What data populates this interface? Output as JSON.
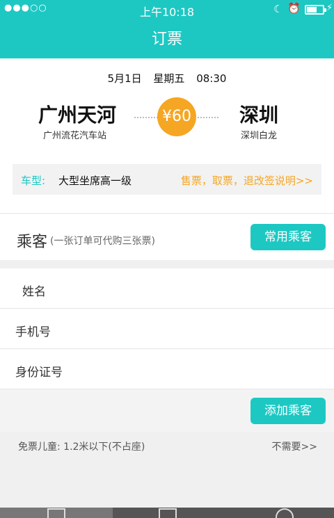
{
  "status_bar": {
    "signal": "●●●○○",
    "time": "上午10:18"
  },
  "nav": {
    "title": "订票"
  },
  "trip": {
    "date": "5月1日",
    "weekday": "星期五",
    "time": "08:30",
    "from_city": "广州天河",
    "from_station": "广州流花汽车站",
    "to_city": "深圳",
    "to_station": "深圳白龙",
    "price": "¥60"
  },
  "vehicle": {
    "label": "车型:",
    "value": "大型坐席高一级",
    "link": "售票，取票，退改签说明>>"
  },
  "passenger": {
    "title": "乘客",
    "note": "(一张订单可代购三张票)",
    "common_button": "常用乘客"
  },
  "form": {
    "name_label": "姓名",
    "phone_label": "手机号",
    "id_label": "身份证号"
  },
  "add_button": "添加乘客",
  "child": {
    "text": "免票儿童: 1.2米以下(不占座)",
    "option": "不需要>>"
  },
  "colors": {
    "accent": "#1dc8c3",
    "price": "#f5a623"
  }
}
